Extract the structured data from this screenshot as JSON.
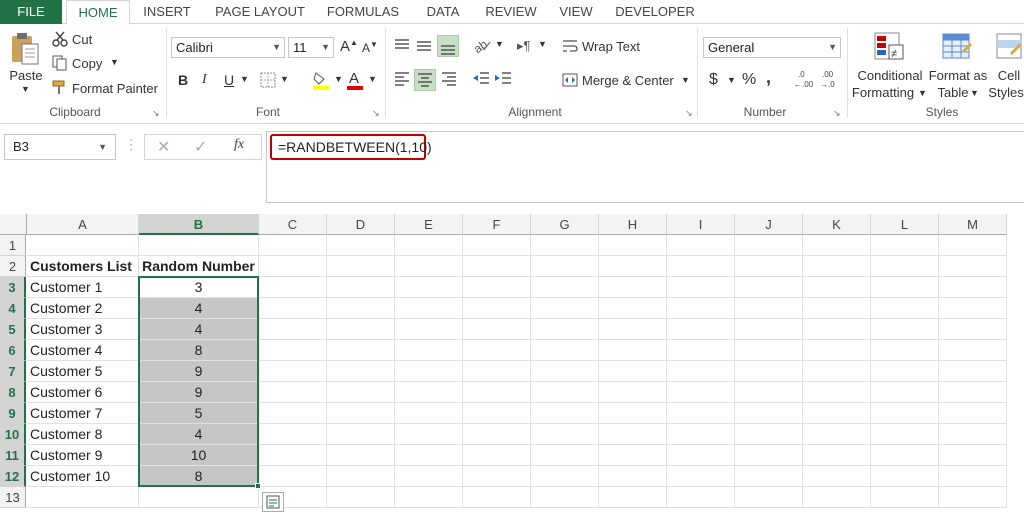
{
  "tabs": [
    {
      "label": "FILE"
    },
    {
      "label": "HOME"
    },
    {
      "label": "INSERT"
    },
    {
      "label": "PAGE LAYOUT"
    },
    {
      "label": "FORMULAS"
    },
    {
      "label": "DATA"
    },
    {
      "label": "REVIEW"
    },
    {
      "label": "VIEW"
    },
    {
      "label": "DEVELOPER"
    }
  ],
  "ribbon": {
    "clipboard": {
      "paste": "Paste",
      "cut": "Cut",
      "copy": "Copy",
      "format_painter": "Format Painter",
      "group": "Clipboard"
    },
    "font": {
      "name": "Calibri",
      "size": "11",
      "group": "Font",
      "bold": "B",
      "italic": "I",
      "underline": "U"
    },
    "alignment": {
      "wrap": "Wrap Text",
      "merge": "Merge & Center",
      "group": "Alignment"
    },
    "number": {
      "format": "General",
      "group": "Number",
      "currency": "$",
      "percent": "%",
      "comma": ","
    },
    "styles": {
      "conditional_1": "Conditional",
      "conditional_2": "Formatting",
      "format_table_1": "Format as",
      "format_table_2": "Table",
      "cell_styles_1": "Cell",
      "cell_styles_2": "Styles",
      "group": "Styles"
    }
  },
  "formula_bar": {
    "name_box": "B3",
    "formula": "=RANDBETWEEN(1,10)",
    "fx": "fx"
  },
  "columns": [
    "A",
    "B",
    "C",
    "D",
    "E",
    "F",
    "G",
    "H",
    "I",
    "J",
    "K",
    "L",
    "M"
  ],
  "rows": [
    {
      "num": "1",
      "a": "",
      "b": ""
    },
    {
      "num": "2",
      "a": "Customers List",
      "b": "Random Number"
    },
    {
      "num": "3",
      "a": "Customer 1",
      "b": "3"
    },
    {
      "num": "4",
      "a": "Customer 2",
      "b": "4"
    },
    {
      "num": "5",
      "a": "Customer 3",
      "b": "4"
    },
    {
      "num": "6",
      "a": "Customer 4",
      "b": "8"
    },
    {
      "num": "7",
      "a": "Customer 5",
      "b": "9"
    },
    {
      "num": "8",
      "a": "Customer 6",
      "b": "9"
    },
    {
      "num": "9",
      "a": "Customer 7",
      "b": "5"
    },
    {
      "num": "10",
      "a": "Customer 8",
      "b": "4"
    },
    {
      "num": "11",
      "a": "Customer 9",
      "b": "10"
    },
    {
      "num": "12",
      "a": "Customer 10",
      "b": "8"
    },
    {
      "num": "13",
      "a": "",
      "b": ""
    }
  ],
  "colors": {
    "accent": "#217346",
    "selection": "#c6c6c6",
    "formula_outline": "#c00000"
  }
}
